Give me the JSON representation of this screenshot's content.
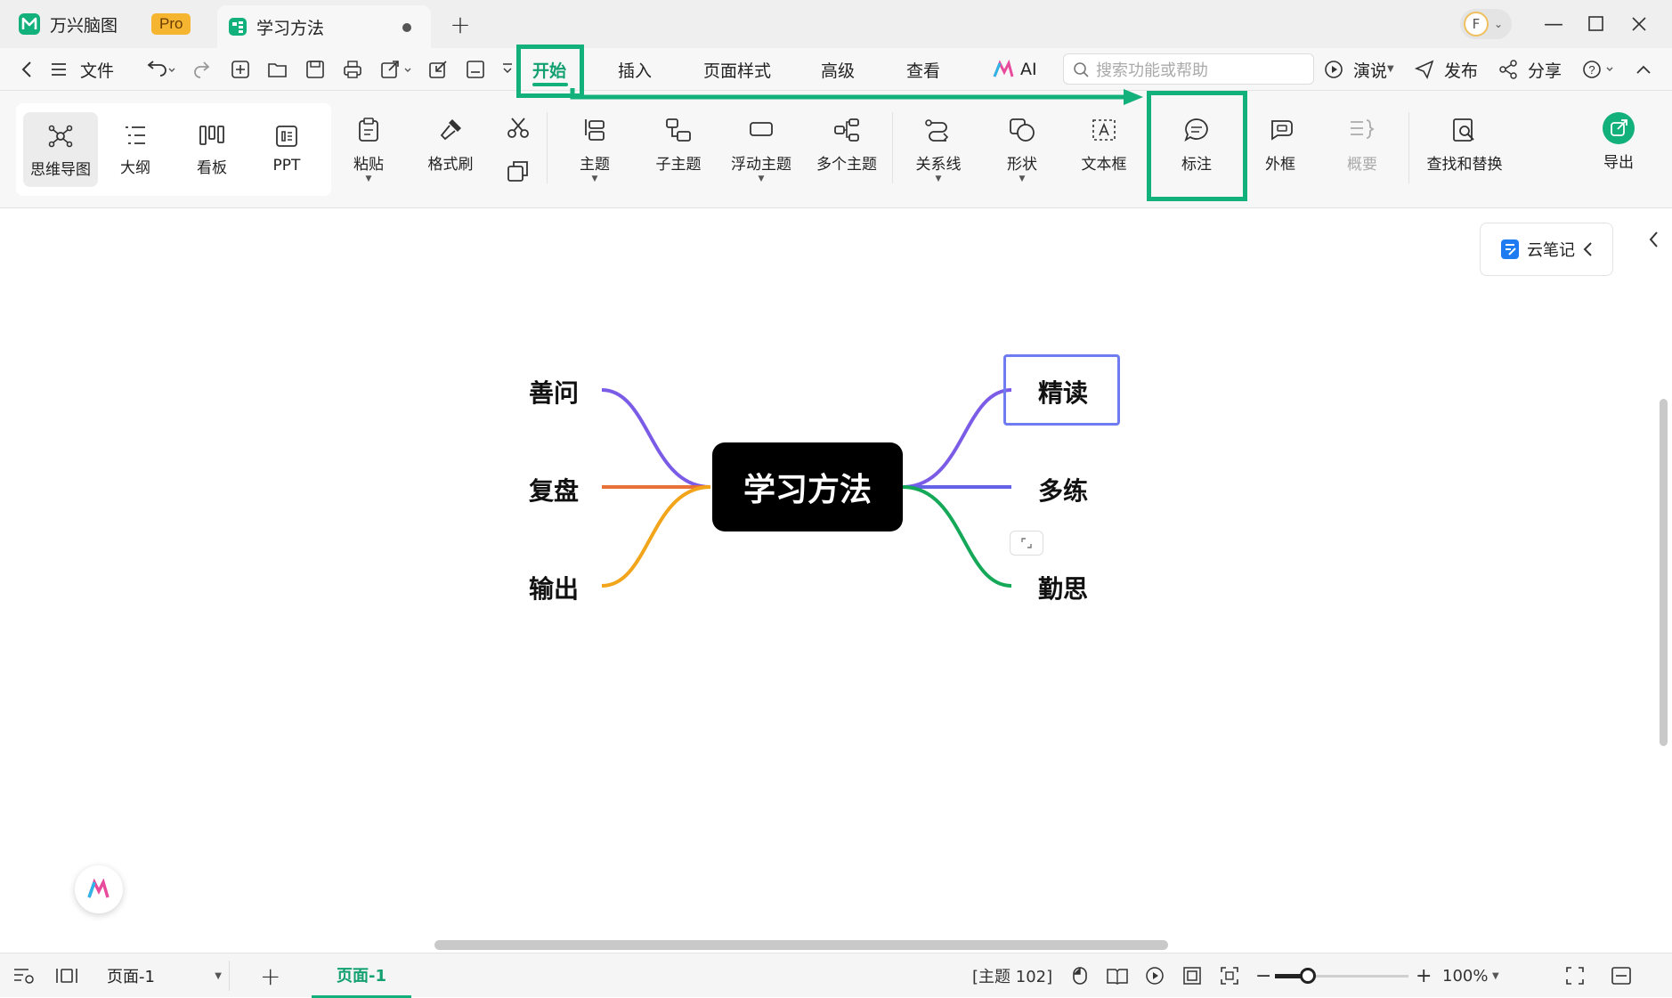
{
  "app": {
    "name": "万兴脑图",
    "badge": "Pro",
    "doc_tab": "学习方法"
  },
  "menu": {
    "file": "文件",
    "tabs": [
      "开始",
      "插入",
      "页面样式",
      "高级",
      "查看",
      "AI"
    ],
    "active_tab": "开始",
    "search_placeholder": "搜索功能或帮助",
    "present": "演说",
    "publish": "发布",
    "share": "分享"
  },
  "ribbon": {
    "views": [
      "思维导图",
      "大纲",
      "看板",
      "PPT"
    ],
    "paste": "粘贴",
    "format_painter": "格式刷",
    "topic": "主题",
    "subtopic": "子主题",
    "floating_topic": "浮动主题",
    "multiple_topics": "多个主题",
    "relationship": "关系线",
    "shape": "形状",
    "textbox": "文本框",
    "callout": "标注",
    "boundary": "外框",
    "summary": "概要",
    "find_replace": "查找和替换",
    "export": "导出"
  },
  "side": {
    "cloud_notes": "云笔记"
  },
  "mindmap": {
    "central": "学习方法",
    "left": [
      "善问",
      "复盘",
      "输出"
    ],
    "right": [
      "精读",
      "多练",
      "勤思"
    ],
    "colors": {
      "left": [
        "#7b5ce6",
        "#e8713a",
        "#f2a51a"
      ],
      "right": [
        "#7b5ce6",
        "#6462e6",
        "#14a858"
      ],
      "selected_border": "#6f7bf0"
    }
  },
  "status": {
    "page_select": "页面-1",
    "page_tab": "页面-1",
    "topic_count": "[主题 102]",
    "zoom": "100%"
  },
  "colors": {
    "accent": "#12b07a",
    "highlight": "#12b07a"
  }
}
